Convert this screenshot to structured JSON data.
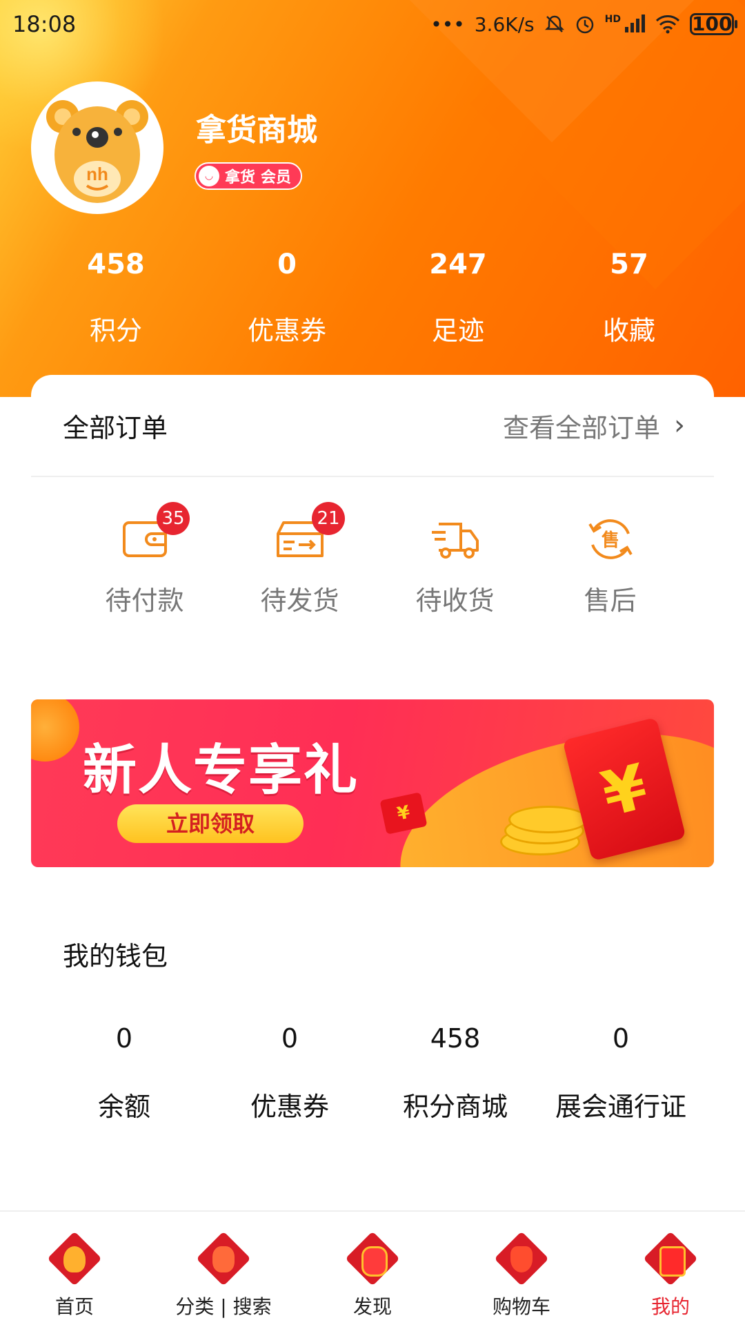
{
  "status_bar": {
    "time": "18:08",
    "network_speed": "3.6K/s",
    "hd_label": "HD",
    "battery": "100",
    "icons": [
      "signal-dots-icon",
      "mute-icon",
      "alarm-icon",
      "cell-signal-icon",
      "wifi-icon",
      "battery-icon"
    ]
  },
  "profile": {
    "name": "拿货商城",
    "badge_brand": "拿货",
    "badge_level": "会员",
    "avatar_text": "nh"
  },
  "stats": [
    {
      "value": "458",
      "label": "积分"
    },
    {
      "value": "0",
      "label": "优惠券"
    },
    {
      "value": "247",
      "label": "足迹"
    },
    {
      "value": "57",
      "label": "收藏"
    }
  ],
  "orders": {
    "title": "全部订单",
    "view_all": "查看全部订单",
    "items": [
      {
        "label": "待付款",
        "badge": "35",
        "icon": "wallet-icon"
      },
      {
        "label": "待发货",
        "badge": "21",
        "icon": "box-icon"
      },
      {
        "label": "待收货",
        "badge": "",
        "icon": "truck-icon"
      },
      {
        "label": "售后",
        "badge": "",
        "icon": "after-sale-icon",
        "glyph": "售"
      }
    ]
  },
  "banner": {
    "title": "新人专享礼",
    "button": "立即领取",
    "yen": "¥"
  },
  "wallet": {
    "title": "我的钱包",
    "items": [
      {
        "value": "0",
        "label": "余额"
      },
      {
        "value": "0",
        "label": "优惠券"
      },
      {
        "value": "458",
        "label": "积分商城"
      },
      {
        "value": "0",
        "label": "展会通行证"
      }
    ]
  },
  "tabbar": [
    {
      "label": "首页",
      "icon": "home-icon"
    },
    {
      "label": "分类 | 搜索",
      "icon": "category-search-icon"
    },
    {
      "label": "发现",
      "icon": "discover-icon"
    },
    {
      "label": "购物车",
      "icon": "cart-icon"
    },
    {
      "label": "我的",
      "icon": "profile-icon",
      "active": true
    }
  ],
  "colors": {
    "brand_orange": "#ff7b00",
    "badge_red": "#e72530",
    "icon_orange": "#f28a1c",
    "active_tab": "#e72530"
  }
}
